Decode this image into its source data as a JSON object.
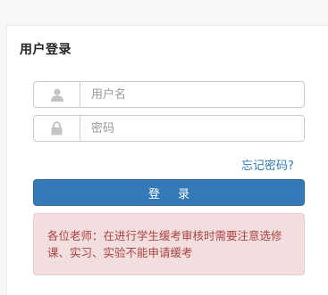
{
  "login": {
    "title": "用户登录",
    "username": {
      "icon": "user-icon",
      "placeholder": "用户名",
      "value": ""
    },
    "password": {
      "icon": "lock-icon",
      "placeholder": "密码",
      "value": ""
    },
    "forgot_password_label": "忘记密码?",
    "submit_label": "登 录",
    "notice_text": "各位老师：在进行学生缓考审核时需要注意选修课、实习、实验不能申请缓考"
  },
  "colors": {
    "primary": "#337ab7",
    "link": "#337ab7",
    "alert_background": "#f2dede",
    "alert_text": "#a94442",
    "icon": "#c4c4c4"
  }
}
